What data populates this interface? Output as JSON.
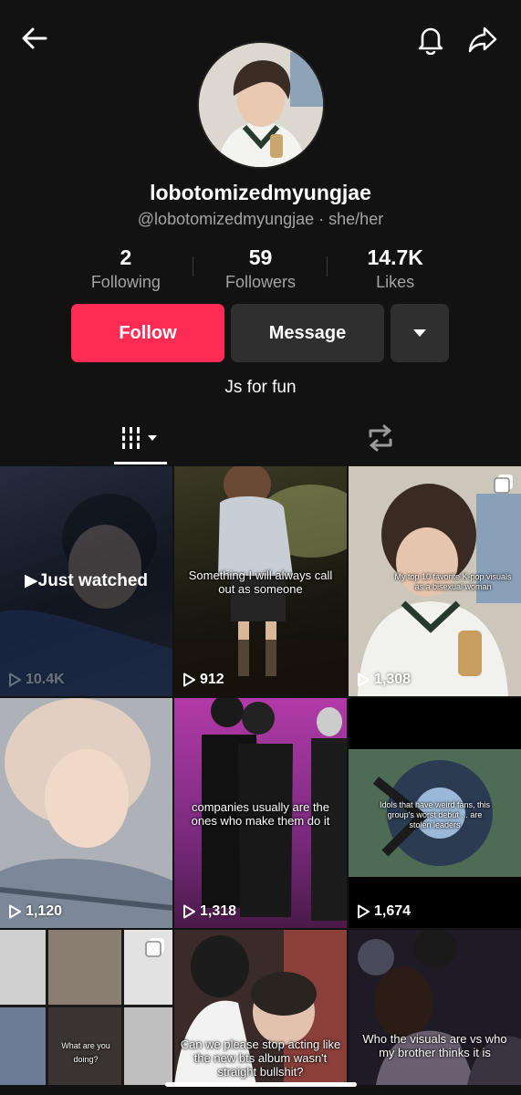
{
  "header": {
    "back_icon": "arrow-left-icon",
    "bell_icon": "bell-icon",
    "share_icon": "share-arrow-icon"
  },
  "profile": {
    "display_name": "lobotomizedmyungjae",
    "handle": "@lobotomizedmyungjae · she/her",
    "bio": "Js for fun"
  },
  "stats": [
    {
      "value": "2",
      "label": "Following"
    },
    {
      "value": "59",
      "label": "Followers"
    },
    {
      "value": "14.7K",
      "label": "Likes"
    }
  ],
  "actions": {
    "follow_label": "Follow",
    "message_label": "Message",
    "follow_color": "#fe2c55"
  },
  "tabs": [
    {
      "icon": "videos-grid-icon",
      "active": true
    },
    {
      "icon": "repost-icon",
      "active": false
    }
  ],
  "videos": [
    {
      "views": "10.4K",
      "overlay": "Just watched",
      "caption": ""
    },
    {
      "views": "912",
      "overlay": "",
      "caption": "Something I will always call out as someone"
    },
    {
      "views": "1,308",
      "overlay": "",
      "caption": "My top 10 favorite K-pop visuals as a bisexual woman"
    },
    {
      "views": "1,120",
      "overlay": "",
      "caption": ""
    },
    {
      "views": "1,318",
      "overlay": "",
      "caption": "companies usually are the ones who make them do it"
    },
    {
      "views": "1,674",
      "overlay": "",
      "caption": "Idols that have weird fans, this group's worst debut ... are stolen leaders"
    },
    {
      "views": "",
      "overlay": "",
      "caption": "What are you doing?"
    },
    {
      "views": "",
      "overlay": "",
      "caption": "Can we please stop acting like the new bts album wasn't straight bullshit?"
    },
    {
      "views": "",
      "overlay": "",
      "caption": "Who the visuals are vs who my brother thinks it is"
    }
  ]
}
